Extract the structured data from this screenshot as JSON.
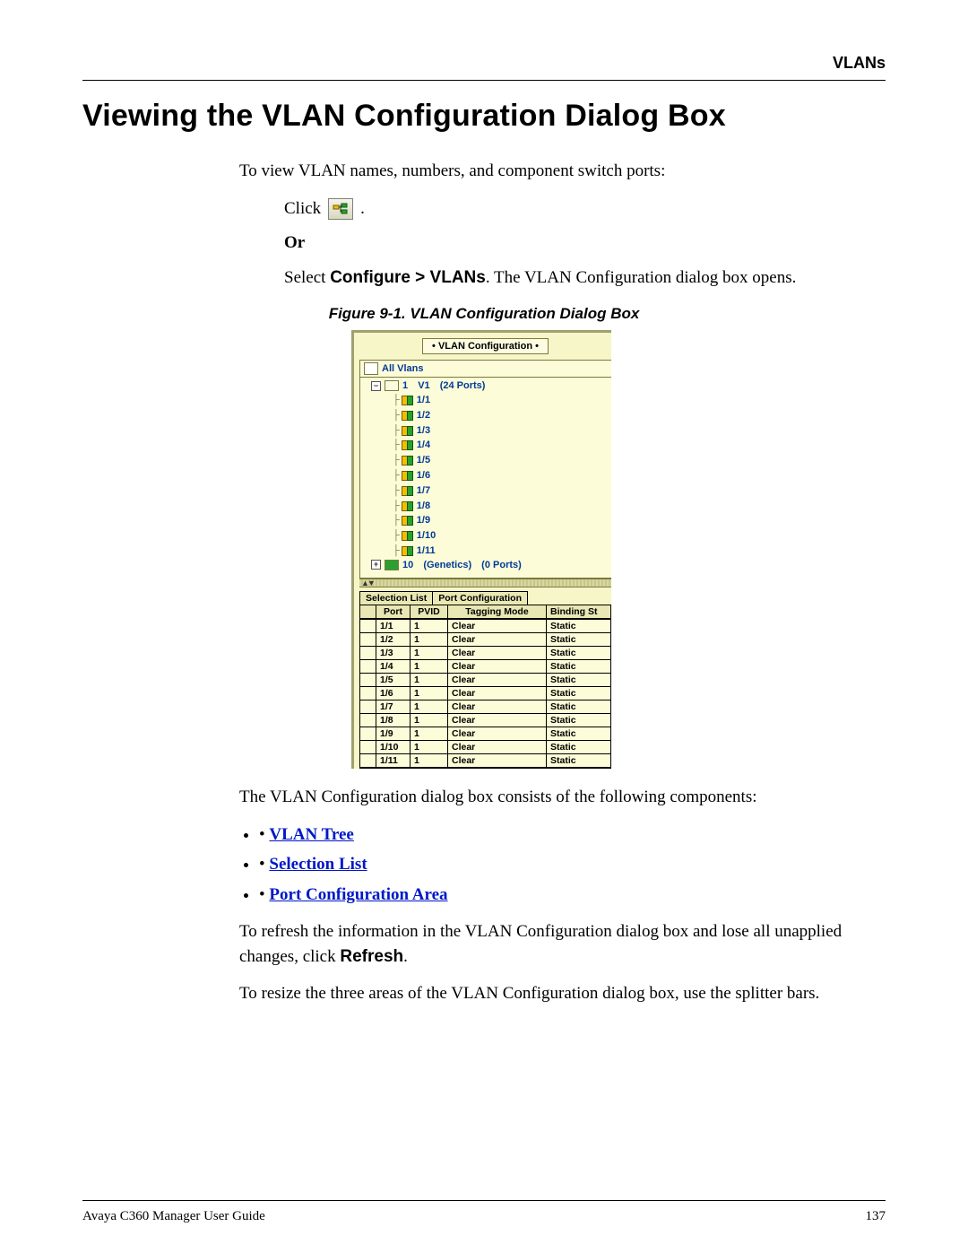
{
  "header": {
    "section": "VLANs"
  },
  "title": "Viewing the VLAN Configuration Dialog Box",
  "intro": "To view VLAN names, numbers, and component switch ports:",
  "steps": {
    "click_word": "Click",
    "click_period": " .",
    "or_word": "Or",
    "select_prefix": "Select ",
    "select_path": "Configure > VLANs",
    "select_suffix": ". The VLAN Configuration dialog box opens."
  },
  "figure": {
    "caption": "Figure 9-1.  VLAN Configuration Dialog Box",
    "dialog_title": "• VLAN Configuration •",
    "tree_header": "All Vlans",
    "vlan1": {
      "id": "1",
      "name": "V1",
      "ports_note": "(24 Ports)"
    },
    "ports": [
      "1/1",
      "1/2",
      "1/3",
      "1/4",
      "1/5",
      "1/6",
      "1/7",
      "1/8",
      "1/9",
      "1/10",
      "1/11"
    ],
    "vlan2": {
      "id": "10",
      "name": "(Genetics)",
      "ports_note": "(0 Ports)"
    },
    "tabs": {
      "selection": "Selection List",
      "portconf": "Port Configuration"
    },
    "columns": {
      "port": "Port",
      "pvid": "PVID",
      "tagging": "Tagging Mode",
      "binding": "Binding St"
    },
    "rows": [
      {
        "port": "1/1",
        "pvid": "1",
        "tag": "Clear",
        "bind": "Static"
      },
      {
        "port": "1/2",
        "pvid": "1",
        "tag": "Clear",
        "bind": "Static"
      },
      {
        "port": "1/3",
        "pvid": "1",
        "tag": "Clear",
        "bind": "Static"
      },
      {
        "port": "1/4",
        "pvid": "1",
        "tag": "Clear",
        "bind": "Static"
      },
      {
        "port": "1/5",
        "pvid": "1",
        "tag": "Clear",
        "bind": "Static"
      },
      {
        "port": "1/6",
        "pvid": "1",
        "tag": "Clear",
        "bind": "Static"
      },
      {
        "port": "1/7",
        "pvid": "1",
        "tag": "Clear",
        "bind": "Static"
      },
      {
        "port": "1/8",
        "pvid": "1",
        "tag": "Clear",
        "bind": "Static"
      },
      {
        "port": "1/9",
        "pvid": "1",
        "tag": "Clear",
        "bind": "Static"
      },
      {
        "port": "1/10",
        "pvid": "1",
        "tag": "Clear",
        "bind": "Static"
      },
      {
        "port": "1/11",
        "pvid": "1",
        "tag": "Clear",
        "bind": "Static"
      }
    ]
  },
  "post": {
    "consists": "The VLAN Configuration dialog box consists of the following components:",
    "links": {
      "tree": "VLAN Tree",
      "selection": "Selection List",
      "portconf": "Port Configuration Area"
    },
    "refresh_prefix": "To refresh the information in the VLAN Configuration dialog box and lose all unapplied changes, click ",
    "refresh_word": "Refresh",
    "refresh_suffix": ".",
    "resize": "To resize the three areas of the VLAN Configuration dialog box, use the splitter bars."
  },
  "footer": {
    "left": "Avaya C360 Manager User Guide",
    "right": "137"
  }
}
